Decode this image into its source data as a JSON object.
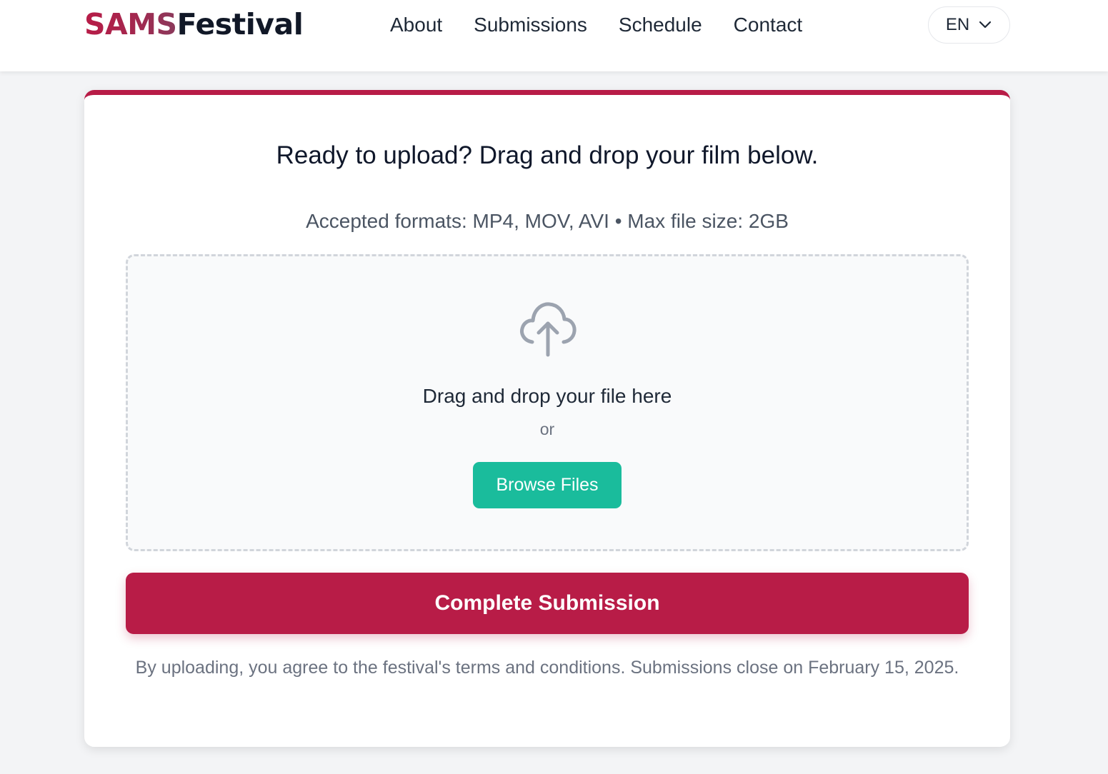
{
  "header": {
    "logo_part1": "SAMS",
    "logo_part2": "Festival",
    "nav": [
      "About",
      "Submissions",
      "Schedule",
      "Contact"
    ],
    "language": "EN",
    "language_icon": "chevron-down-icon"
  },
  "upload": {
    "title": "Ready to upload? Drag and drop your film below.",
    "formats": "Accepted formats: MP4, MOV, AVI • Max file size: 2GB",
    "icon": "cloud-upload-icon",
    "drop_text": "Drag and drop your file here",
    "or_text": "or",
    "browse_label": "Browse Files",
    "submit_label": "Complete Submission",
    "terms": "By uploading, you agree to the festival's terms and conditions. Submissions close on February 15, 2025."
  },
  "colors": {
    "brand": "#b81c47",
    "browse_button": "#1abc9c"
  }
}
